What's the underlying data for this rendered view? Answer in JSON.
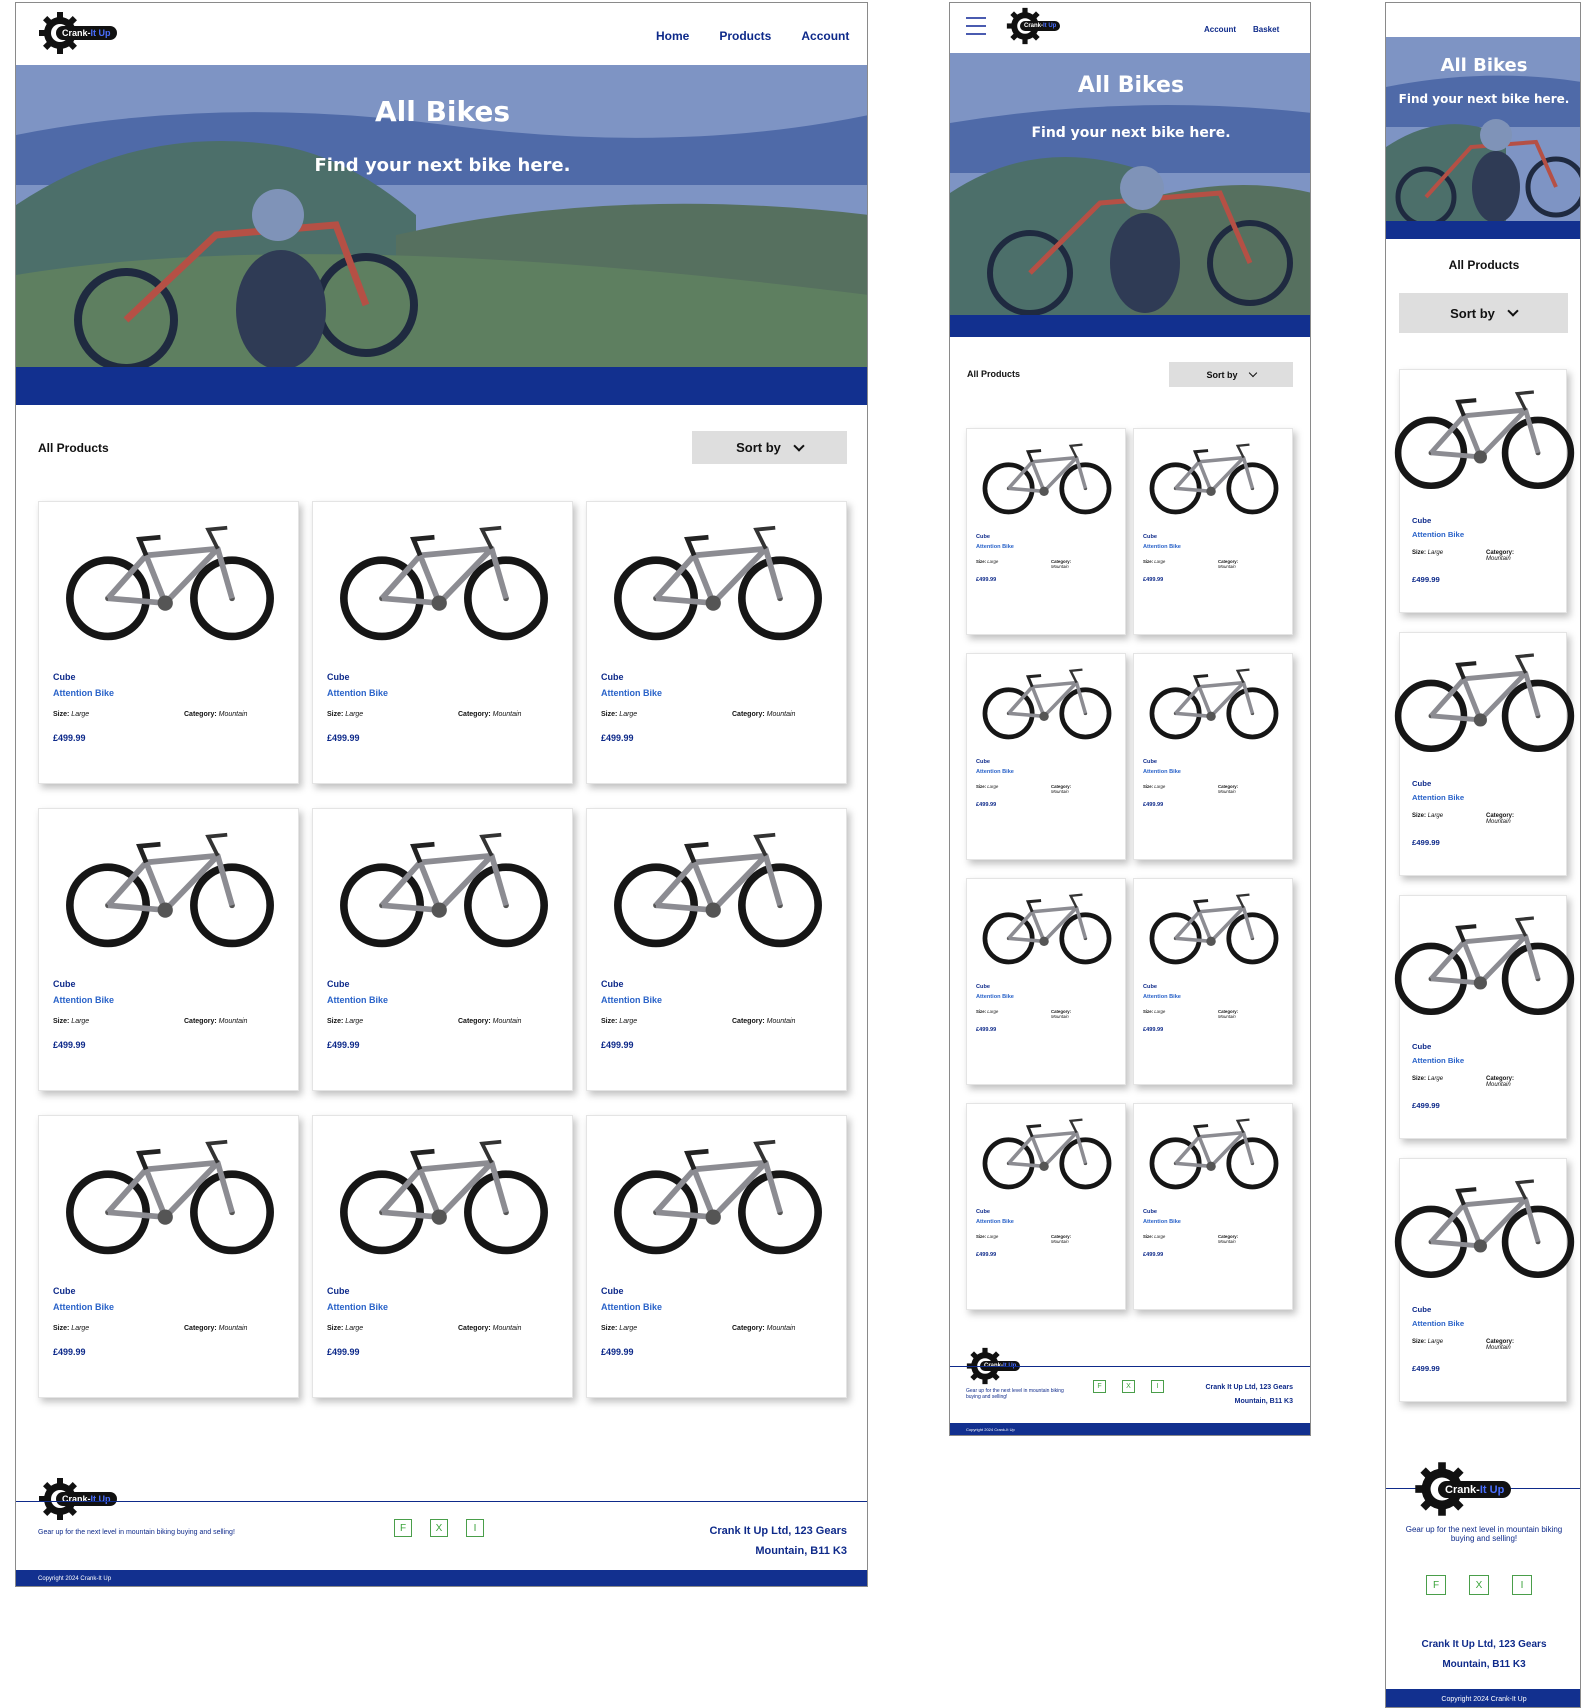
{
  "brand": {
    "logo_text": "Crank-",
    "logo_accent": "It Up"
  },
  "nav": {
    "home": "Home",
    "products": "Products",
    "account": "Account",
    "basket": "Basket"
  },
  "hero": {
    "title": "All Bikes",
    "subtitle": "Find your next bike here."
  },
  "toolbar": {
    "section_title": "All Products",
    "sort_label": "Sort by"
  },
  "product": {
    "brand": "Cube",
    "model": "Attention Bike",
    "size_label": "Size:",
    "size_value": "Large",
    "category_label": "Category:",
    "category_value": "Mountain",
    "price": "£499.99"
  },
  "footer": {
    "tagline": "Gear up for the next level in mountain biking buying and selling!",
    "social": [
      "F",
      "X",
      "I"
    ],
    "address_line1": "Crank It Up Ltd, 123 Gears",
    "address_line2": "Mountain, B11 K3",
    "copyright": "Copyright 2024 Crank-It Up"
  },
  "colors": {
    "primary": "#12308f",
    "accent": "#2a63c9",
    "social": "#3aa33a"
  },
  "icons": [
    "gear-logo-icon",
    "chevron-down-icon",
    "hamburger-menu-icon"
  ]
}
